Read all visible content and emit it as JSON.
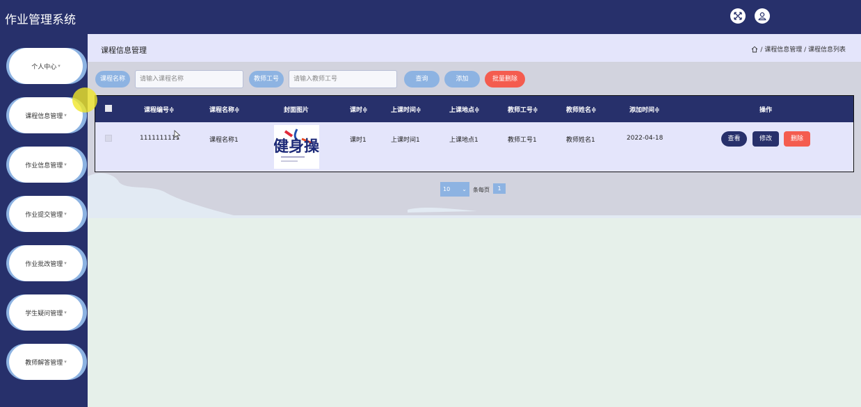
{
  "app": {
    "title": "作业管理系统"
  },
  "header": {
    "fullscreen_icon": "expand-icon",
    "user_icon": "user-icon"
  },
  "sidebar": {
    "items": [
      {
        "label": "个人中心"
      },
      {
        "label": "课程信息管理"
      },
      {
        "label": "作业信息管理"
      },
      {
        "label": "作业提交管理"
      },
      {
        "label": "作业批改管理"
      },
      {
        "label": "学生疑问管理"
      },
      {
        "label": "教师解答管理"
      }
    ],
    "caret": "▾"
  },
  "breadcrumb": {
    "title": "课程信息管理",
    "path": "/ 课程信息管理 / 课程信息列表"
  },
  "search": {
    "course_name_label": "课程名称",
    "course_name_placeholder": "请输入课程名称",
    "teacher_id_label": "教师工号",
    "teacher_id_placeholder": "请输入教师工号",
    "query_button": "查询",
    "add_button": "添加",
    "batch_delete_button": "批量删除"
  },
  "table": {
    "columns": [
      "课程编号≑",
      "课程名称≑",
      "封面图片",
      "课时≑",
      "上课时间≑",
      "上课地点≑",
      "教师工号≑",
      "教师姓名≑",
      "添加时间≑",
      "操作"
    ],
    "rows": [
      {
        "course_no": "1111111111",
        "course_name": "课程名称1",
        "cover_text": "健身操",
        "hours": "课时1",
        "class_time": "上课时间1",
        "location": "上课地点1",
        "teacher_id": "教师工号1",
        "teacher_name": "教师姓名1",
        "added": "2022-04-18",
        "actions": {
          "view": "查看",
          "edit": "修改",
          "delete": "删除"
        }
      }
    ]
  },
  "pagination": {
    "page_size": "10",
    "per_page_label": "条每页",
    "current_page": "1"
  },
  "colors": {
    "nav": "#27306b",
    "accent": "#8db3e2",
    "danger": "#f45c4f"
  }
}
